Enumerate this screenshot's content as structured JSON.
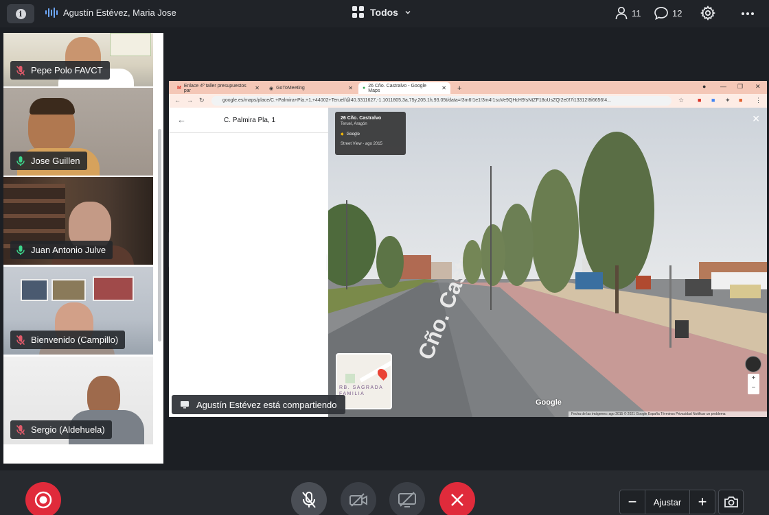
{
  "topbar": {
    "info_icon": "info-icon",
    "active_speakers": "Agustín Estévez, Maria Jose",
    "layout_label": "Todos",
    "participants_count": "11",
    "chat_count": "12"
  },
  "participants": [
    {
      "name": "Pepe Polo FAVCT",
      "mic": "muted"
    },
    {
      "name": "Jose Guillen",
      "mic": "on"
    },
    {
      "name": "Juan Antonio Julve",
      "mic": "on"
    },
    {
      "name": "Bienvenido (Campillo)",
      "mic": "muted"
    },
    {
      "name": "Sergio (Aldehuela)",
      "mic": "muted"
    }
  ],
  "browser": {
    "tabs": [
      {
        "label": "Enlace 4º taller presupuestos par"
      },
      {
        "label": "GoToMeeting"
      },
      {
        "label": "26 Cño. Castralvo - Google Maps"
      }
    ],
    "url": "google.es/maps/place/C.+Palmira+Pla,+1,+44002+Teruel/@40.3311627,-1.1011805,3a,75y,205.1h,93.05t/data=!3m6!1e1!3m4!1suVe9QHcH9!sNtZF18oUsZQ!2e0!7i13312!8i6656!4..."
  },
  "maps": {
    "place_title": "C. Palmira Pla, 1",
    "sv_title": "26 Cño. Castralvo",
    "sv_location": "Teruel, Aragón",
    "sv_source": "Google",
    "sv_date": "Street View - ago 2015",
    "minimap_label": "RB. SAGRADA FAMILIA",
    "google_logo": "Google",
    "legal": "Fecha de las imágenes: ago 2015   © 2021 Google   España   Términos   Privacidad   Notificar un problema"
  },
  "banner": {
    "text": "Agustín Estévez está compartiendo"
  },
  "bottombar": {
    "zoom_label": "Ajustar"
  },
  "colors": {
    "record": "#e02b3b",
    "leave": "#e02b3b",
    "mic_on": "#3dd68c",
    "mic_off": "#e05a6a"
  }
}
